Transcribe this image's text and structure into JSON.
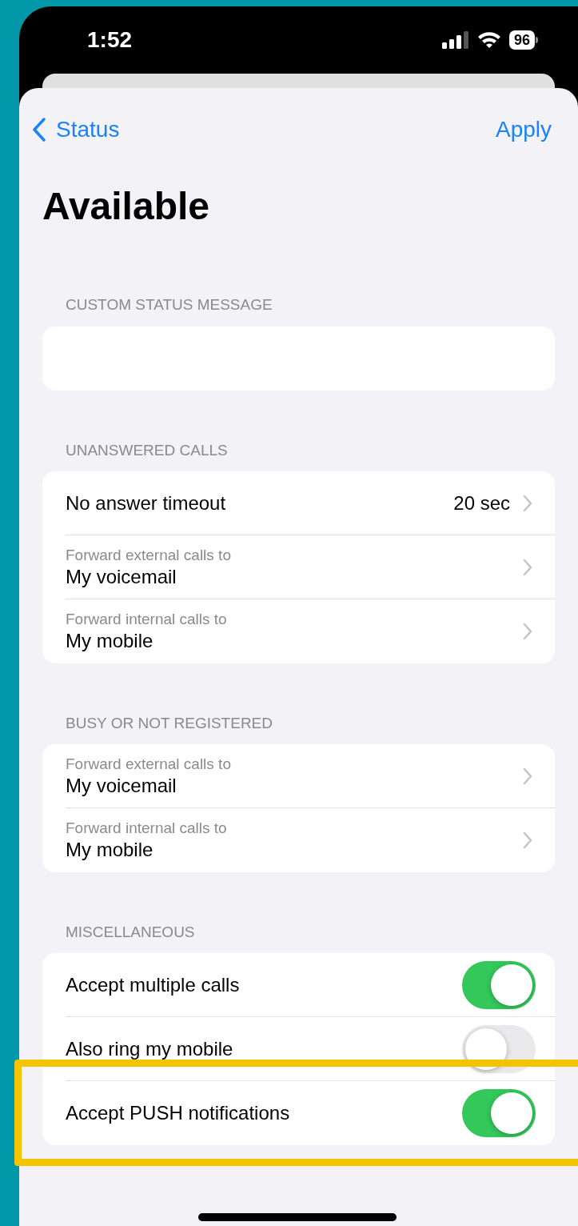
{
  "status_bar": {
    "time": "1:52",
    "battery": "96"
  },
  "nav": {
    "back": "Status",
    "action": "Apply",
    "title": "Available"
  },
  "sections": [
    {
      "header": "CUSTOM STATUS MESSAGE",
      "kind": "field"
    },
    {
      "header": "UNANSWERED CALLS",
      "kind": "list",
      "rows": [
        {
          "kind": "value",
          "label": "No answer timeout",
          "value": "20 sec"
        },
        {
          "kind": "forward",
          "caption": "Forward external calls to",
          "label": "My voicemail"
        },
        {
          "kind": "forward",
          "caption": "Forward internal calls to",
          "label": "My mobile"
        }
      ]
    },
    {
      "header": "BUSY OR NOT REGISTERED",
      "kind": "list",
      "rows": [
        {
          "kind": "forward",
          "caption": "Forward external calls to",
          "label": "My voicemail"
        },
        {
          "kind": "forward",
          "caption": "Forward internal calls to",
          "label": "My mobile"
        }
      ]
    },
    {
      "header": "MISCELLANEOUS",
      "kind": "list",
      "rows": [
        {
          "kind": "toggle",
          "label": "Accept multiple calls",
          "on": true
        },
        {
          "kind": "toggle",
          "label": "Also ring my mobile",
          "on": false
        },
        {
          "kind": "toggle",
          "label": "Accept PUSH notifications",
          "on": true
        }
      ]
    }
  ]
}
